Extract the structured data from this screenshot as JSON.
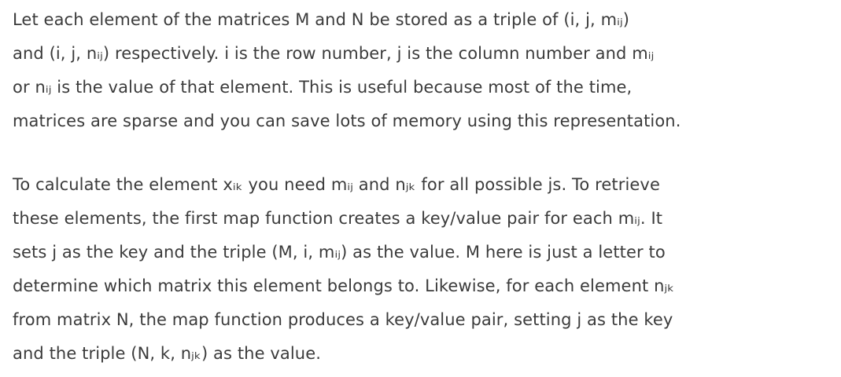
{
  "document": {
    "paragraphs": [
      "Let each element of the matrices M and N be stored as a triple of (i, j, mᵢⱼ)\nand (i, j, nᵢⱼ) respectively. i is the row number, j is the column number and mᵢⱼ\nor nᵢⱼ is the value of that element. This is useful because most of the time,\nmatrices are sparse and you can save lots of memory using this representation.",
      "To calculate the element xᵢₖ you need mᵢⱼ and nⱼₖ for all possible js. To retrieve\nthese elements, the first map function creates a key/value pair for each mᵢⱼ. It\nsets j as the key and the triple (M, i, mᵢⱼ) as the value. M here is just a letter to\ndetermine which matrix this element belongs to. Likewise, for each element nⱼₖ\nfrom matrix N, the map function produces a key/value pair, setting j as the key\nand the triple (N, k, nⱼₖ) as the value."
    ]
  }
}
